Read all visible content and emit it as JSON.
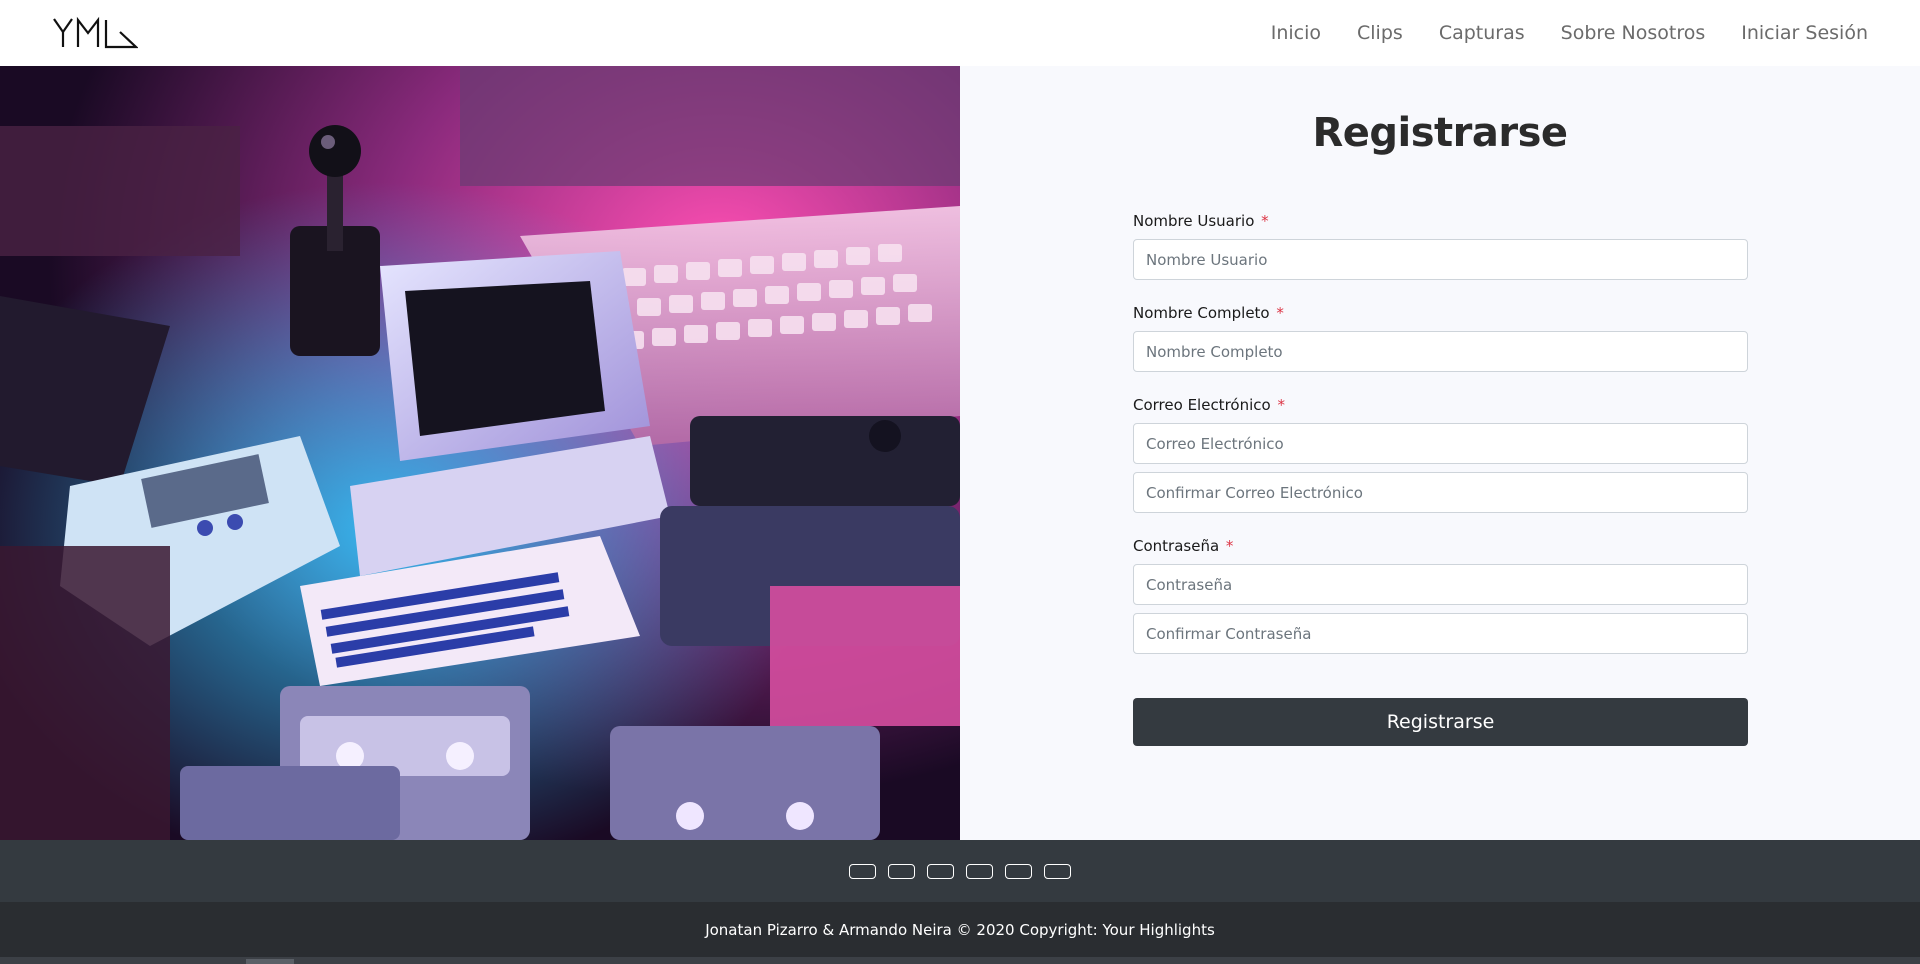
{
  "brand": {
    "logo_text": "YHL"
  },
  "nav": {
    "items": [
      {
        "label": "Inicio"
      },
      {
        "label": "Clips"
      },
      {
        "label": "Capturas"
      },
      {
        "label": "Sobre Nosotros"
      },
      {
        "label": "Iniciar Sesión"
      }
    ]
  },
  "form": {
    "title": "Registrarse",
    "username": {
      "label": "Nombre Usuario",
      "required_mark": "*",
      "placeholder": "Nombre Usuario",
      "value": ""
    },
    "fullname": {
      "label": "Nombre Completo",
      "required_mark": "*",
      "placeholder": "Nombre Completo",
      "value": ""
    },
    "email": {
      "label": "Correo Electrónico",
      "required_mark": "*",
      "placeholder": "Correo Electrónico",
      "value": ""
    },
    "email_confirm": {
      "placeholder": "Confirmar Correo Electrónico",
      "value": ""
    },
    "password": {
      "label": "Contraseña",
      "required_mark": "*",
      "placeholder": "Contraseña",
      "value": ""
    },
    "password_confirm": {
      "placeholder": "Confirmar Contraseña",
      "value": ""
    },
    "submit_label": "Registrarse"
  },
  "footer": {
    "social_buttons": [
      "social-link-1",
      "social-link-2",
      "social-link-3",
      "social-link-4",
      "social-link-5",
      "social-link-6"
    ],
    "copyright": "Jonatan Pizarro & Armando Neira © 2020 Copyright: Your Highlights"
  },
  "colors": {
    "nav_text": "#6b6b6b",
    "panel_bg": "#f8f9fd",
    "button_bg": "#343a40",
    "required": "#dc3545",
    "footer_top": "#343a40",
    "footer_bottom": "#2a2d31"
  },
  "hero_image": {
    "subject": "retro-computers-neon-photo"
  }
}
